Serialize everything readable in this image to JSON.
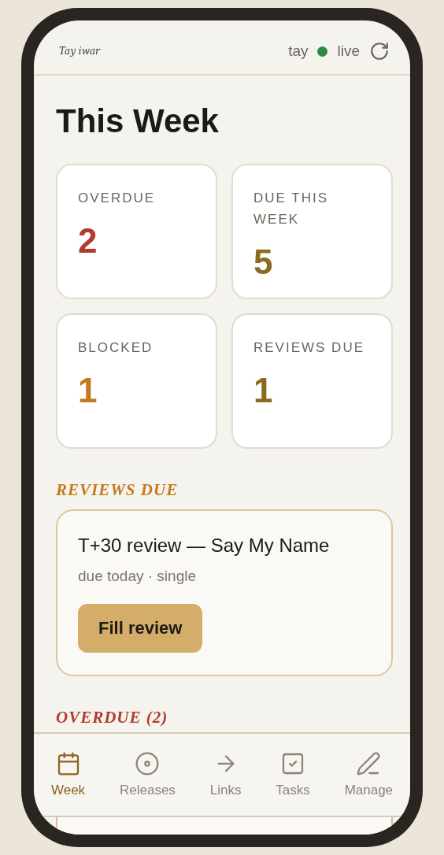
{
  "header": {
    "logo": "Tay iwar",
    "user": "tay",
    "status": {
      "label": "live",
      "live": true
    }
  },
  "title": "This Week",
  "stats": [
    {
      "label": "OVERDUE",
      "value": "2",
      "color": "#b23a2e"
    },
    {
      "label": "DUE THIS WEEK",
      "value": "5",
      "color": "#8a6a1f"
    },
    {
      "label": "BLOCKED",
      "value": "1",
      "color": "#c47a1c"
    },
    {
      "label": "REVIEWS DUE",
      "value": "1",
      "color": "#8a6a1f"
    }
  ],
  "reviews_section": {
    "heading": "REVIEWS DUE",
    "cards": [
      {
        "title": "T+30 review — Say My Name",
        "meta": "due today · single",
        "action": "Fill review"
      }
    ]
  },
  "overdue_section": {
    "heading": "OVERDUE (2)"
  },
  "nav": [
    {
      "label": "Week",
      "selected": true
    },
    {
      "label": "Releases",
      "selected": false
    },
    {
      "label": "Links",
      "selected": false
    },
    {
      "label": "Tasks",
      "selected": false
    },
    {
      "label": "Manage",
      "selected": false
    }
  ]
}
